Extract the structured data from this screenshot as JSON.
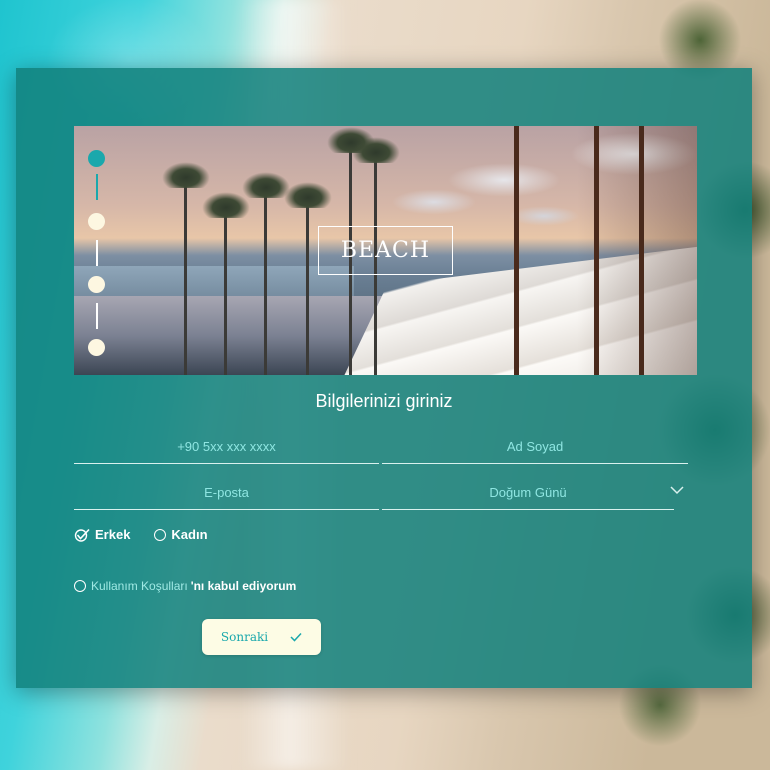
{
  "hero": {
    "badge": "BEACH"
  },
  "steps": {
    "count": 4,
    "active_index": 0
  },
  "form": {
    "title": "Bilgilerinizi giriniz",
    "phone": {
      "placeholder": "+90 5xx xxx xxxx"
    },
    "name": {
      "placeholder": "Ad Soyad"
    },
    "email": {
      "placeholder": "E-posta"
    },
    "birthday": {
      "placeholder": "Doğum Günü"
    },
    "gender": [
      {
        "label": "Erkek",
        "checked": true
      },
      {
        "label": "Kadın",
        "checked": false
      }
    ],
    "terms": {
      "link_text": "Kullanım Koşulları",
      "rest_text": "'nı kabul ediyorum",
      "checked": false
    },
    "next_button": {
      "label": "Sonraki"
    }
  },
  "colors": {
    "panel": "#12807c",
    "accent": "#1aa8ac",
    "placeholder": "#8fe6e2",
    "button_bg": "#fdfce5"
  }
}
